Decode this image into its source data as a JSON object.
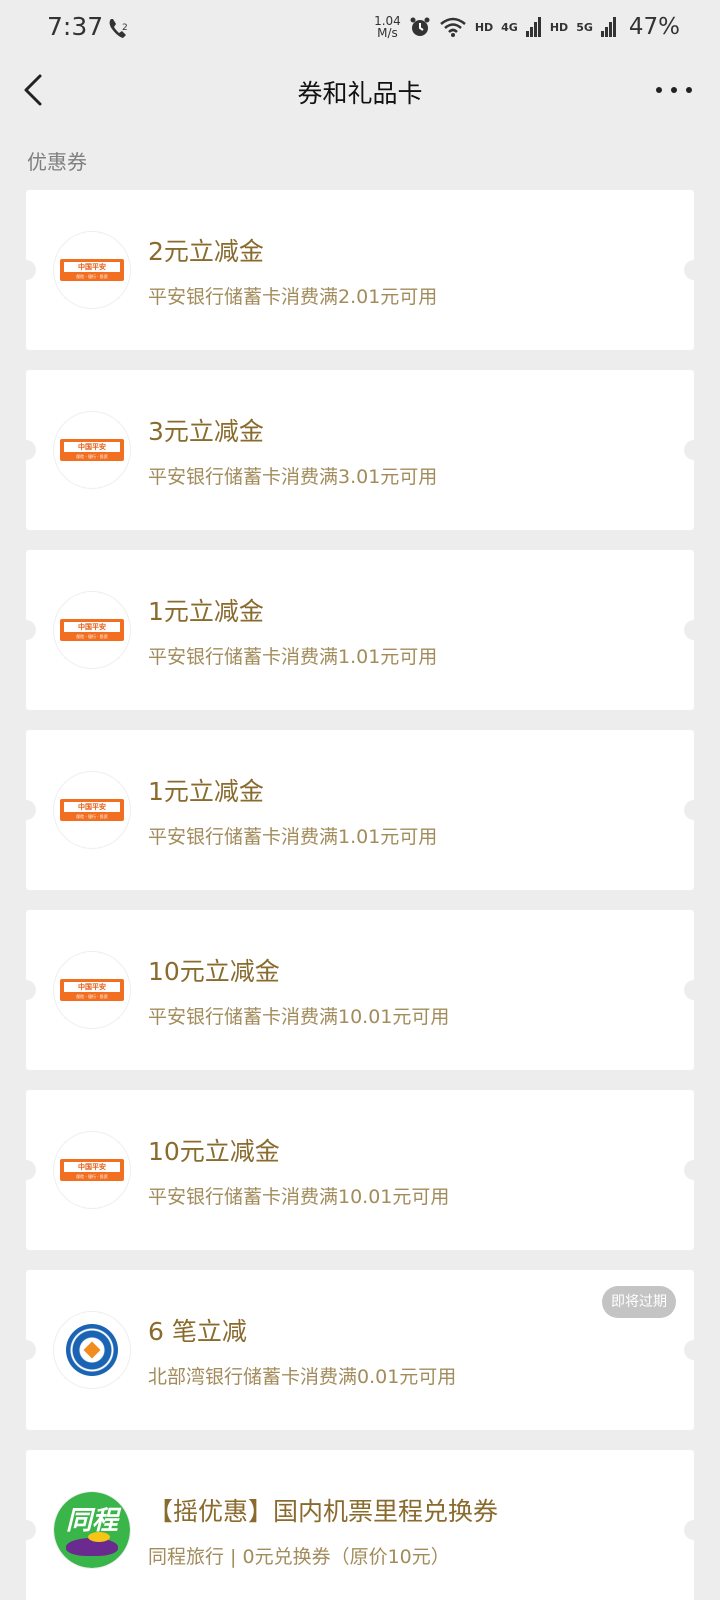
{
  "status_bar": {
    "time": "7:37",
    "call_icon": "hd-call-icon",
    "net_speed_value": "1.04",
    "net_speed_unit": "M/s",
    "hd_1": "HD",
    "signal_1_label": "4G",
    "hd_2": "HD",
    "signal_2_label": "5G",
    "battery": "47%"
  },
  "nav": {
    "back_icon": "chevron-left-icon",
    "title": "券和礼品卡",
    "more_icon": "more-dots-icon"
  },
  "section": {
    "label": "优惠券"
  },
  "coupons": [
    {
      "title": "2元立减金",
      "desc": "平安银行储蓄卡消费满2.01元可用",
      "logo": "ping-an-logo"
    },
    {
      "title": "3元立减金",
      "desc": "平安银行储蓄卡消费满3.01元可用",
      "logo": "ping-an-logo"
    },
    {
      "title": "1元立减金",
      "desc": "平安银行储蓄卡消费满1.01元可用",
      "logo": "ping-an-logo"
    },
    {
      "title": "1元立减金",
      "desc": "平安银行储蓄卡消费满1.01元可用",
      "logo": "ping-an-logo"
    },
    {
      "title": "10元立减金",
      "desc": "平安银行储蓄卡消费满10.01元可用",
      "logo": "ping-an-logo"
    },
    {
      "title": "10元立减金",
      "desc": "平安银行储蓄卡消费满10.01元可用",
      "logo": "ping-an-logo"
    },
    {
      "title": "6 笔立减",
      "desc": "北部湾银行储蓄卡消费满0.01元可用",
      "logo": "beibuwan-bank-logo",
      "badge": "即将过期"
    },
    {
      "title": "【摇优惠】国内机票里程兑换券",
      "desc": "同程旅行 | 0元兑换券（原价10元）",
      "logo": "tongcheng-logo"
    }
  ],
  "logos": {
    "ping_an_text": "中国平安",
    "ping_an_sub": "保险 · 银行 · 投资",
    "tongcheng_text": "同程"
  },
  "colors": {
    "background": "#ededed",
    "card": "#ffffff",
    "coupon_title": "#8a6b2e",
    "coupon_desc": "#a38c5c",
    "ping_an_orange": "#f26f21",
    "badge_gray": "#c4c4c4"
  }
}
